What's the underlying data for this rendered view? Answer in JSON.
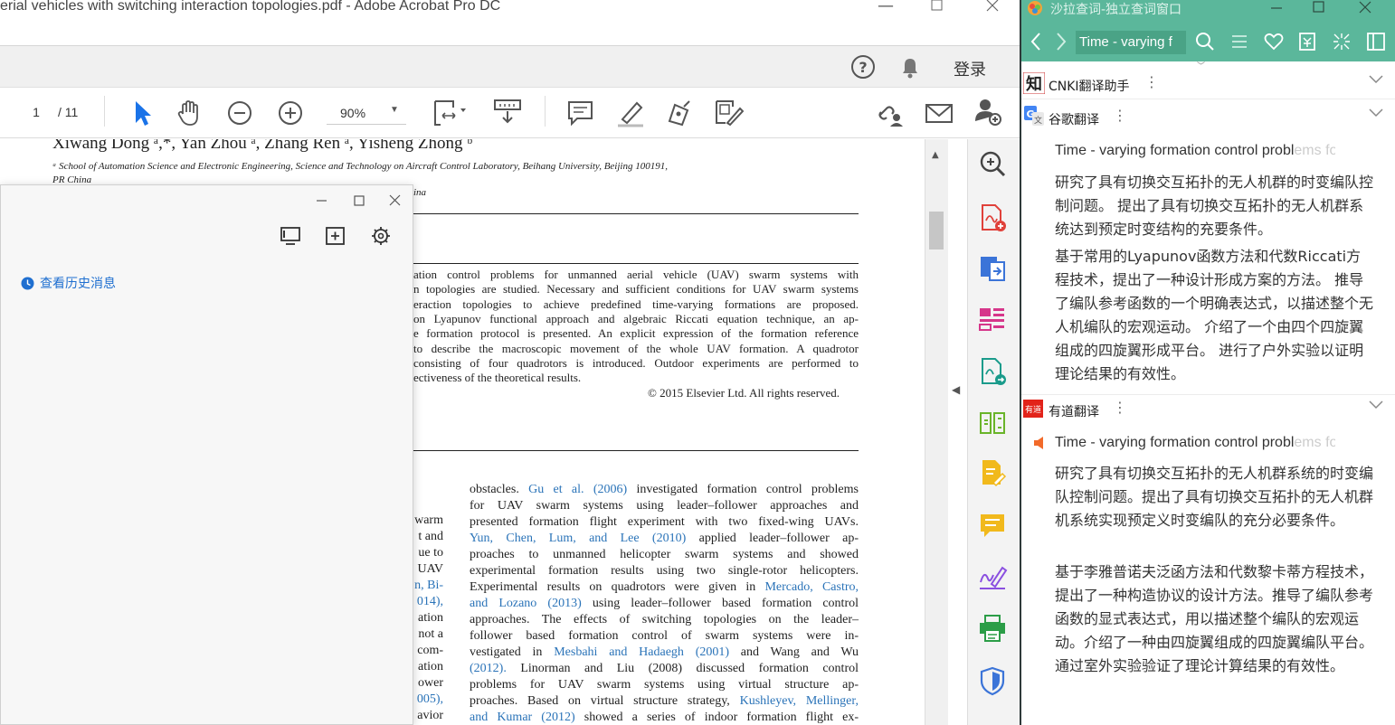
{
  "acrobat": {
    "title": "erial vehicles with switching interaction topologies.pdf - Adobe Acrobat Pro DC",
    "login": "登录",
    "page_current": "1",
    "page_total": "/ 11",
    "zoom": "90%"
  },
  "document": {
    "authors": "Xiwang Dong ᵃ,*, Yan Zhou ᵃ, Zhang Ren ᵃ, Yisheng Zhong ᵇ",
    "affil_a": "ᵃ School of Automation Science and Electronic Engineering, Science and Technology on Aircraft Control Laboratory, Beihang University, Beijing 100191,",
    "affil_a2": "PR China",
    "affil_b": "ina",
    "abstract_lines": [
      "ation control problems for unmanned aerial vehicle (UAV) swarm systems with",
      "n topologies are studied. Necessary and sufficient conditions for UAV swarm systems",
      "eraction topologies to achieve predefined time-varying formations are proposed.",
      "on Lyapunov functional approach and algebraic Riccati equation technique, an ap-",
      "e formation protocol is presented. An explicit expression of the formation reference",
      "to describe the macroscopic movement of the whole UAV formation. A quadrotor",
      "consisting of four quadrotors is introduced. Outdoor experiments are performed to",
      "ectiveness of the theoretical results."
    ],
    "copyright": "© 2015 Elsevier Ltd. All rights reserved.",
    "left_col": [
      "warm",
      "t and",
      "ue to",
      "UAV",
      "n, Bi-",
      "014),",
      "ation",
      "not a",
      "com-",
      "ation",
      "ower",
      "005),",
      "avior"
    ],
    "right_col": [
      {
        "pre": "obstacles. ",
        "link": "Gu et al. (2006)",
        "post": " investigated formation control problems"
      },
      {
        "pre": "for UAV swarm systems using leader–follower approaches and",
        "link": "",
        "post": ""
      },
      {
        "pre": "presented formation flight experiment with two fixed-wing UAVs.",
        "link": "",
        "post": ""
      },
      {
        "pre": "",
        "link": "Yun, Chen, Lum, and Lee (2010)",
        "post": " applied leader–follower ap-"
      },
      {
        "pre": "proaches to unmanned helicopter swarm systems and showed",
        "link": "",
        "post": ""
      },
      {
        "pre": "experimental formation results using two single-rotor helicopters.",
        "link": "",
        "post": ""
      },
      {
        "pre": "Experimental results on quadrotors were given in ",
        "link": "Mercado, Castro,",
        "post": ""
      },
      {
        "pre": "",
        "link": "and Lozano (2013)",
        "post": " using leader–follower based formation control"
      },
      {
        "pre": "approaches. The effects of switching topologies on the leader–",
        "link": "",
        "post": ""
      },
      {
        "pre": "follower based formation control of swarm systems were in-",
        "link": "",
        "post": ""
      },
      {
        "pre": "vestigated in ",
        "link": "Mesbahi and Hadaegh (2001)",
        "post": " and Wang and Wu"
      },
      {
        "pre": "",
        "link": "(2012).",
        "post": " Linorman and Liu (2008) discussed formation control"
      },
      {
        "pre": "problems for UAV swarm systems using virtual structure ap-",
        "link": "",
        "post": ""
      },
      {
        "pre": "proaches. Based on virtual structure strategy, ",
        "link": "Kushleyev, Mellinger,",
        "post": ""
      },
      {
        "pre": "",
        "link": "and Kumar (2012)",
        "post": " showed a series of indoor formation flight ex-"
      }
    ]
  },
  "floating_window": {
    "history_label": "查看历史消息"
  },
  "sala": {
    "title": "沙拉查词-独立查词窗口",
    "search_text": "Time - varying f",
    "cnki_name": "CNKI翻译助手",
    "google_name": "谷歌翻译",
    "google_src": "Time - varying formation control problems fo",
    "google_p1": "研究了具有切换交互拓扑的无人机群的时变编队控制问题。 提出了具有切换交互拓扑的无人机群系统达到预定时变结构的充要条件。",
    "google_p2": "基于常用的Lyapunov函数方法和代数Riccati方程技术，提出了一种设计形成方案的方法。 推导了编队参考函数的一个明确表达式，以描述整个无人机编队的宏观运动。 介绍了一个由四个四旋翼组成的四旋翼形成平台。 进行了户外实验以证明理论结果的有效性。",
    "youdao_name": "有道翻译",
    "youdao_src": "Time - varying formation control problems fo",
    "youdao_p1": "研究了具有切换交互拓扑的无人机群系统的时变编队控制问题。提出了具有切换交互拓扑的无人机群机系统实现预定义时变编队的充分必要条件。",
    "youdao_p2": "基于李雅普诺夫泛函方法和代数黎卡蒂方程技术，提出了一种构造协议的设计方法。推导了编队参考函数的显式表达式，用以描述整个编队的宏观运动。介绍了一种由四旋翼组成的四旋翼编队平台。通过室外实验验证了理论计算结果的有效性。",
    "accent": "#5bb79b"
  }
}
